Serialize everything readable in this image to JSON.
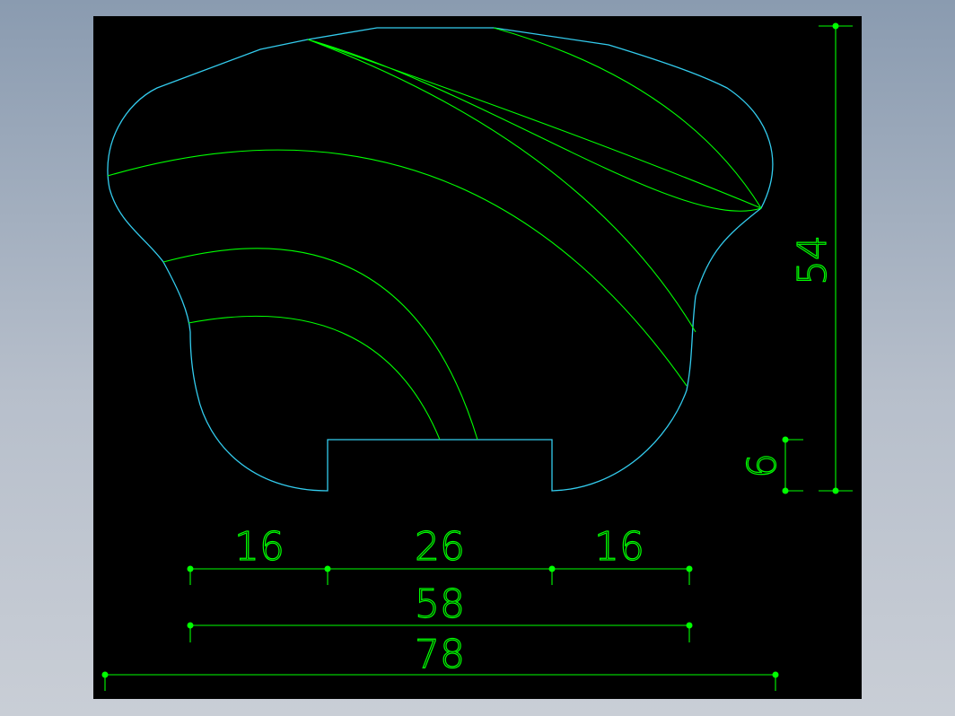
{
  "colors": {
    "background": "#000000",
    "outline": "#33ccee",
    "curve": "#00ff00",
    "dimension": "#00ff00"
  },
  "dimensions": {
    "height_total": "54",
    "notch_depth": "6",
    "left_segment": "16",
    "notch_width": "26",
    "right_segment": "16",
    "inner_width": "58",
    "overall_width": "78"
  }
}
